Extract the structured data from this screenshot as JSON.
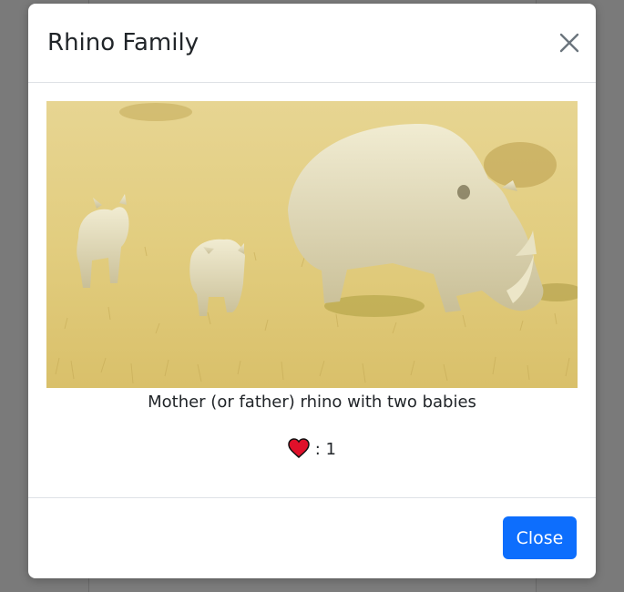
{
  "modal": {
    "title": "Rhino Family",
    "caption": "Mother (or father) rhino with two babies",
    "likes_text": ": 1",
    "likes_count": 1,
    "heart_icon": "heart-icon",
    "close_icon": "close-icon",
    "close_button_label": "Close"
  },
  "colors": {
    "primary": "#0d6efd",
    "heart": "#e0102a",
    "backdrop": "#7a7a7a"
  }
}
